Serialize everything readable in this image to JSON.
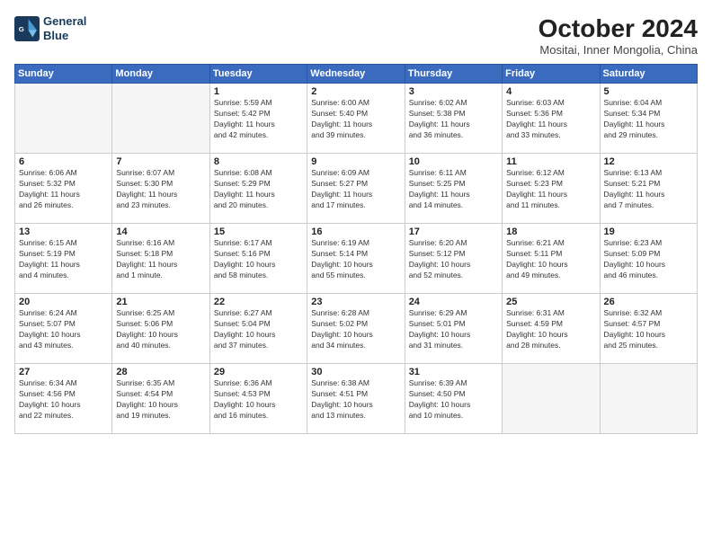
{
  "header": {
    "logo": "General Blue",
    "month": "October 2024",
    "location": "Mositai, Inner Mongolia, China"
  },
  "days_of_week": [
    "Sunday",
    "Monday",
    "Tuesday",
    "Wednesday",
    "Thursday",
    "Friday",
    "Saturday"
  ],
  "weeks": [
    [
      {
        "num": "",
        "info": ""
      },
      {
        "num": "",
        "info": ""
      },
      {
        "num": "1",
        "info": "Sunrise: 5:59 AM\nSunset: 5:42 PM\nDaylight: 11 hours\nand 42 minutes."
      },
      {
        "num": "2",
        "info": "Sunrise: 6:00 AM\nSunset: 5:40 PM\nDaylight: 11 hours\nand 39 minutes."
      },
      {
        "num": "3",
        "info": "Sunrise: 6:02 AM\nSunset: 5:38 PM\nDaylight: 11 hours\nand 36 minutes."
      },
      {
        "num": "4",
        "info": "Sunrise: 6:03 AM\nSunset: 5:36 PM\nDaylight: 11 hours\nand 33 minutes."
      },
      {
        "num": "5",
        "info": "Sunrise: 6:04 AM\nSunset: 5:34 PM\nDaylight: 11 hours\nand 29 minutes."
      }
    ],
    [
      {
        "num": "6",
        "info": "Sunrise: 6:06 AM\nSunset: 5:32 PM\nDaylight: 11 hours\nand 26 minutes."
      },
      {
        "num": "7",
        "info": "Sunrise: 6:07 AM\nSunset: 5:30 PM\nDaylight: 11 hours\nand 23 minutes."
      },
      {
        "num": "8",
        "info": "Sunrise: 6:08 AM\nSunset: 5:29 PM\nDaylight: 11 hours\nand 20 minutes."
      },
      {
        "num": "9",
        "info": "Sunrise: 6:09 AM\nSunset: 5:27 PM\nDaylight: 11 hours\nand 17 minutes."
      },
      {
        "num": "10",
        "info": "Sunrise: 6:11 AM\nSunset: 5:25 PM\nDaylight: 11 hours\nand 14 minutes."
      },
      {
        "num": "11",
        "info": "Sunrise: 6:12 AM\nSunset: 5:23 PM\nDaylight: 11 hours\nand 11 minutes."
      },
      {
        "num": "12",
        "info": "Sunrise: 6:13 AM\nSunset: 5:21 PM\nDaylight: 11 hours\nand 7 minutes."
      }
    ],
    [
      {
        "num": "13",
        "info": "Sunrise: 6:15 AM\nSunset: 5:19 PM\nDaylight: 11 hours\nand 4 minutes."
      },
      {
        "num": "14",
        "info": "Sunrise: 6:16 AM\nSunset: 5:18 PM\nDaylight: 11 hours\nand 1 minute."
      },
      {
        "num": "15",
        "info": "Sunrise: 6:17 AM\nSunset: 5:16 PM\nDaylight: 10 hours\nand 58 minutes."
      },
      {
        "num": "16",
        "info": "Sunrise: 6:19 AM\nSunset: 5:14 PM\nDaylight: 10 hours\nand 55 minutes."
      },
      {
        "num": "17",
        "info": "Sunrise: 6:20 AM\nSunset: 5:12 PM\nDaylight: 10 hours\nand 52 minutes."
      },
      {
        "num": "18",
        "info": "Sunrise: 6:21 AM\nSunset: 5:11 PM\nDaylight: 10 hours\nand 49 minutes."
      },
      {
        "num": "19",
        "info": "Sunrise: 6:23 AM\nSunset: 5:09 PM\nDaylight: 10 hours\nand 46 minutes."
      }
    ],
    [
      {
        "num": "20",
        "info": "Sunrise: 6:24 AM\nSunset: 5:07 PM\nDaylight: 10 hours\nand 43 minutes."
      },
      {
        "num": "21",
        "info": "Sunrise: 6:25 AM\nSunset: 5:06 PM\nDaylight: 10 hours\nand 40 minutes."
      },
      {
        "num": "22",
        "info": "Sunrise: 6:27 AM\nSunset: 5:04 PM\nDaylight: 10 hours\nand 37 minutes."
      },
      {
        "num": "23",
        "info": "Sunrise: 6:28 AM\nSunset: 5:02 PM\nDaylight: 10 hours\nand 34 minutes."
      },
      {
        "num": "24",
        "info": "Sunrise: 6:29 AM\nSunset: 5:01 PM\nDaylight: 10 hours\nand 31 minutes."
      },
      {
        "num": "25",
        "info": "Sunrise: 6:31 AM\nSunset: 4:59 PM\nDaylight: 10 hours\nand 28 minutes."
      },
      {
        "num": "26",
        "info": "Sunrise: 6:32 AM\nSunset: 4:57 PM\nDaylight: 10 hours\nand 25 minutes."
      }
    ],
    [
      {
        "num": "27",
        "info": "Sunrise: 6:34 AM\nSunset: 4:56 PM\nDaylight: 10 hours\nand 22 minutes."
      },
      {
        "num": "28",
        "info": "Sunrise: 6:35 AM\nSunset: 4:54 PM\nDaylight: 10 hours\nand 19 minutes."
      },
      {
        "num": "29",
        "info": "Sunrise: 6:36 AM\nSunset: 4:53 PM\nDaylight: 10 hours\nand 16 minutes."
      },
      {
        "num": "30",
        "info": "Sunrise: 6:38 AM\nSunset: 4:51 PM\nDaylight: 10 hours\nand 13 minutes."
      },
      {
        "num": "31",
        "info": "Sunrise: 6:39 AM\nSunset: 4:50 PM\nDaylight: 10 hours\nand 10 minutes."
      },
      {
        "num": "",
        "info": ""
      },
      {
        "num": "",
        "info": ""
      }
    ]
  ]
}
